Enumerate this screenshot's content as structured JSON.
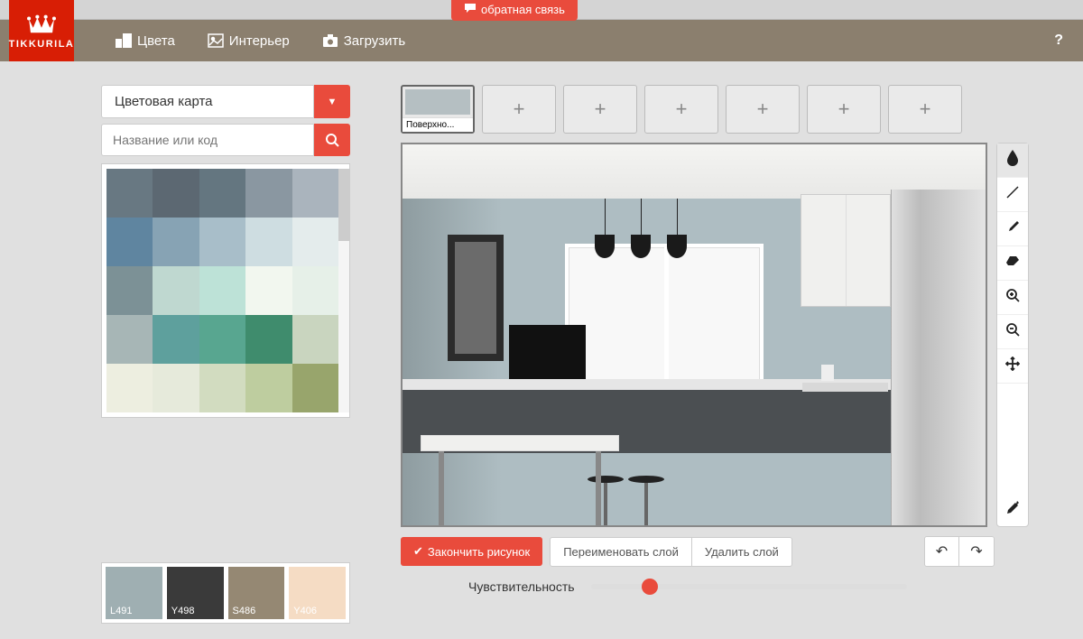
{
  "feedback": {
    "label": "обратная связь"
  },
  "brand": "TIKKURILA",
  "nav": {
    "colors": "Цвета",
    "interior": "Интерьер",
    "upload": "Загрузить"
  },
  "sidebar": {
    "dropdown_label": "Цветовая карта",
    "search_placeholder": "Название или код",
    "swatches": [
      "#687882",
      "#5c6872",
      "#647680",
      "#8a97a1",
      "#aab4bd",
      "#5f85a0",
      "#87a3b4",
      "#a8bec9",
      "#cedde1",
      "#e4ecec",
      "#7c9196",
      "#bfd8d0",
      "#bde2d7",
      "#f2f7ef",
      "#e6f0e8",
      "#a7b6b6",
      "#5ea09d",
      "#58a690",
      "#3f8c6d",
      "#c9d5bf",
      "#edeee0",
      "#e6eadb",
      "#d2dcc0",
      "#becd9f",
      "#98a56c"
    ]
  },
  "selected": [
    {
      "code": "L491",
      "hex": "#9fafb2"
    },
    {
      "code": "Y498",
      "hex": "#3a3a3a"
    },
    {
      "code": "S486",
      "hex": "#958873"
    },
    {
      "code": "Y406",
      "hex": "#f5dcc4"
    }
  ],
  "surfaces": {
    "active_label": "Поверхно..."
  },
  "actions": {
    "finish": "Закончить рисунок",
    "rename": "Переименовать слой",
    "delete": "Удалить слой"
  },
  "sensitivity": {
    "label": "Чувствительность"
  }
}
